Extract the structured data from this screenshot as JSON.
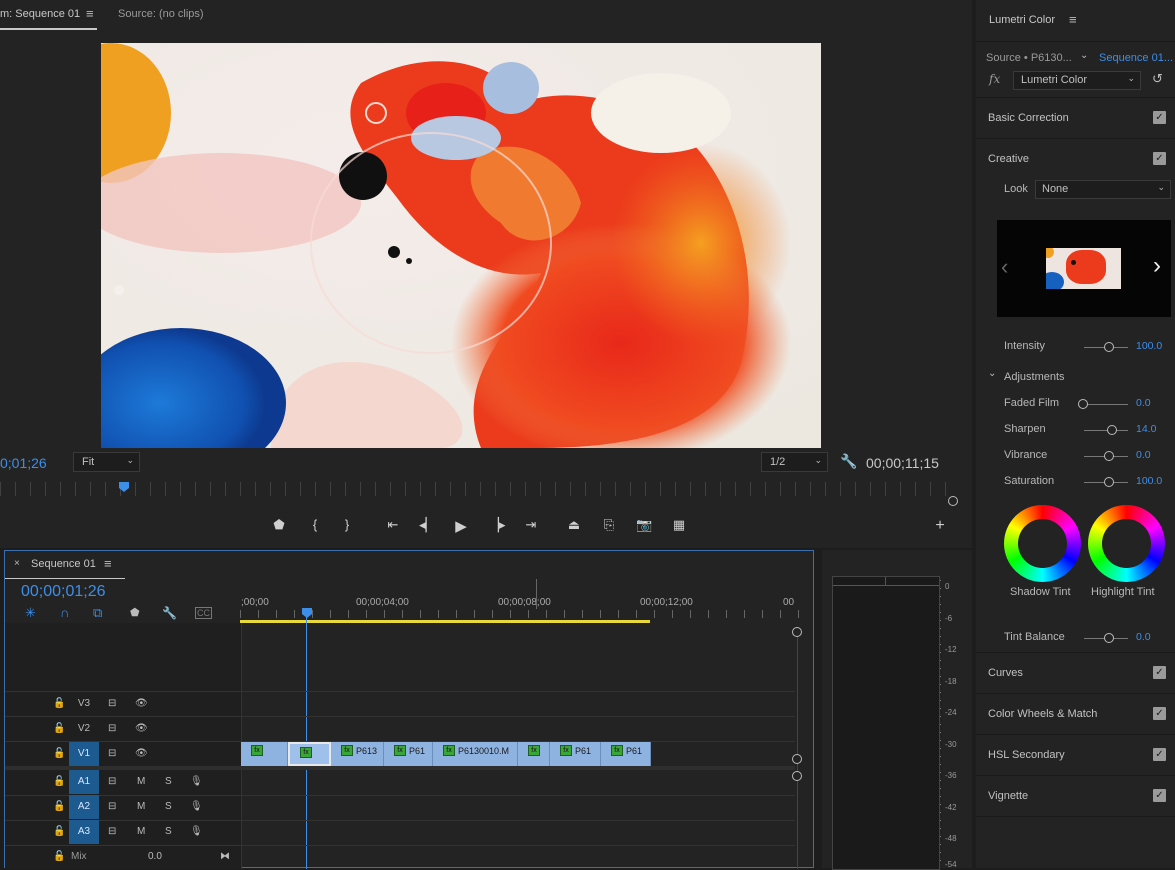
{
  "program_monitor": {
    "tab_title": "m: Sequence 01",
    "source_tab": "Source: (no clips)",
    "timecode_left": "0;01;26",
    "fit_label": "Fit",
    "resolution": "1/2",
    "timecode_right": "00;00;11;15"
  },
  "timeline": {
    "tab_title": "Sequence 01",
    "timecode": "00;00;01;26",
    "ruler": [
      ";00;00",
      "00;00;04;00",
      "00;00;08;00",
      "00;00;12;00",
      "00"
    ],
    "tracks_video": [
      "V3",
      "V2",
      "V1"
    ],
    "tracks_audio": [
      "A1",
      "A2",
      "A3"
    ],
    "mix_label": "Mix",
    "mix_value": "0.0",
    "clips": [
      "",
      "",
      "P613",
      "P61",
      "P6130010.M",
      "",
      "P61",
      "P61"
    ]
  },
  "meter": {
    "db_labels": [
      "0",
      "-6",
      "-12",
      "-18",
      "-24",
      "-30",
      "-36",
      "-42",
      "-48",
      "-54"
    ]
  },
  "lumetri": {
    "title": "Lumetri Color",
    "source_label": "Source • P6130...",
    "sequence_label": "Sequence 01...",
    "effect_select": "Lumetri Color",
    "sections": {
      "basic": "Basic Correction",
      "creative": "Creative",
      "curves": "Curves",
      "wheels": "Color Wheels & Match",
      "hsl": "HSL Secondary",
      "vignette": "Vignette"
    },
    "look_label": "Look",
    "look_value": "None",
    "intensity_label": "Intensity",
    "intensity_value": "100.0",
    "adjustments_label": "Adjustments",
    "faded_film_label": "Faded Film",
    "faded_film_value": "0.0",
    "sharpen_label": "Sharpen",
    "sharpen_value": "14.0",
    "vibrance_label": "Vibrance",
    "vibrance_value": "0.0",
    "saturation_label": "Saturation",
    "saturation_value": "100.0",
    "shadow_tint_label": "Shadow Tint",
    "highlight_tint_label": "Highlight Tint",
    "tint_balance_label": "Tint Balance",
    "tint_balance_value": "0.0"
  },
  "colors": {
    "accent": "#3d8ee9",
    "clip": "#8fb3e0",
    "playhead": "#3d8ee9",
    "work_area": "#e8d83a"
  }
}
